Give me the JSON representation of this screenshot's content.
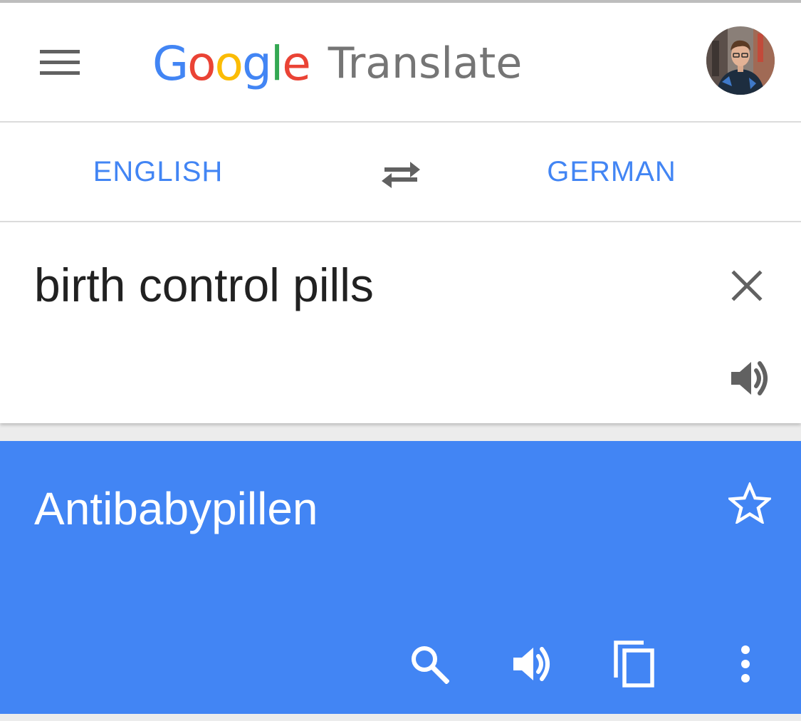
{
  "app_bar": {
    "logo_letters": [
      {
        "char": "G",
        "color": "#4285f4"
      },
      {
        "char": "o",
        "color": "#ea4335"
      },
      {
        "char": "o",
        "color": "#fbbc05"
      },
      {
        "char": "g",
        "color": "#4285f4"
      },
      {
        "char": "l",
        "color": "#34a853"
      },
      {
        "char": "e",
        "color": "#ea4335"
      }
    ],
    "product_name": "Translate",
    "menu_icon": "hamburger-menu-icon",
    "avatar_icon": "user-avatar"
  },
  "language_bar": {
    "source_language": "ENGLISH",
    "target_language": "GERMAN",
    "swap_icon": "swap-arrows-icon"
  },
  "input": {
    "text": "birth control pills",
    "clear_icon": "close-icon",
    "listen_icon": "speaker-icon"
  },
  "result": {
    "text": "Antibabypillen",
    "star_icon": "star-outline-icon",
    "actions": [
      "search-icon",
      "speaker-icon",
      "copy-icon",
      "more-vert-icon"
    ]
  },
  "colors": {
    "accent": "#4285f4",
    "icon_gray": "#616161",
    "text_dark": "#212121"
  }
}
